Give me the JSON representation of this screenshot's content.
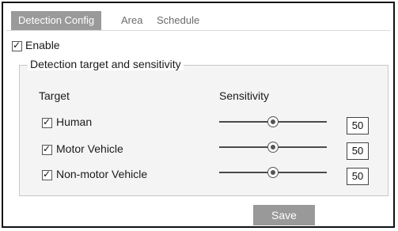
{
  "tabs": [
    {
      "label": "Detection Config",
      "active": true
    },
    {
      "label": "Area",
      "active": false
    },
    {
      "label": "Schedule",
      "active": false
    }
  ],
  "enable": {
    "label": "Enable",
    "checked": true
  },
  "section": {
    "legend": "Detection target and sensitivity",
    "col_target": "Target",
    "col_sensitivity": "Sensitivity",
    "rows": [
      {
        "label": "Human",
        "checked": true,
        "sensitivity": 50,
        "max": 100
      },
      {
        "label": "Motor Vehicle",
        "checked": true,
        "sensitivity": 50,
        "max": 100
      },
      {
        "label": "Non-motor Vehicle",
        "checked": true,
        "sensitivity": 50,
        "max": 100
      }
    ]
  },
  "save_label": "Save",
  "colors": {
    "active_tab": "#9a9a9a",
    "button": "#999999",
    "panel_bg": "#f4f4f4"
  }
}
